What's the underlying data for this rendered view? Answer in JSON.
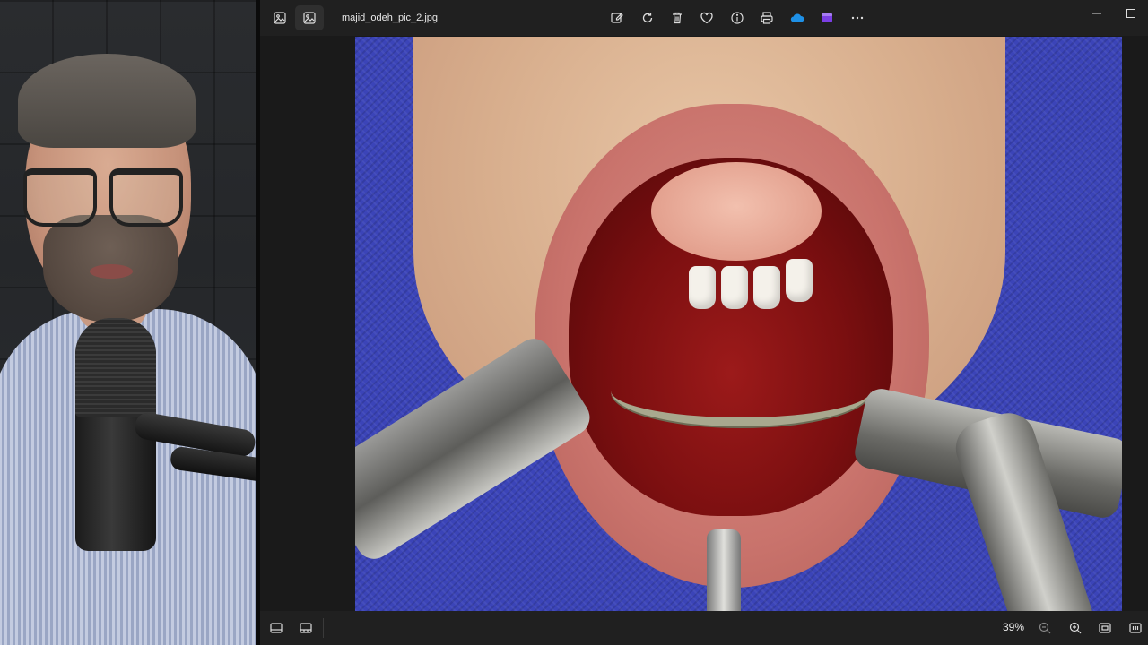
{
  "app": {
    "filename": "majid_odeh_pic_2.jpg"
  },
  "toolbar": {
    "icons": [
      "edit-image-icon",
      "rotate-icon",
      "delete-icon",
      "favorite-icon",
      "info-icon",
      "print-icon",
      "onedrive-icon",
      "clipchamp-icon",
      "more-icon"
    ]
  },
  "bottom": {
    "zoom": "39%"
  },
  "colors": {
    "app_bg": "#202020",
    "viewer_bg": "#1a1a1a",
    "drape": "#3b44b8",
    "onedrive": "#1e90e6",
    "clipchamp": "#7b3fe4"
  }
}
